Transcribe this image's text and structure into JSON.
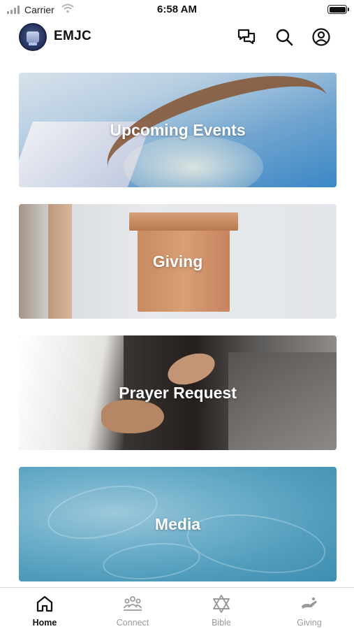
{
  "status_bar": {
    "carrier": "Carrier",
    "time": "6:58 AM"
  },
  "header": {
    "brand": "EMJC",
    "icons": [
      "chat-icon",
      "search-icon",
      "profile-icon"
    ]
  },
  "cards": [
    {
      "title": "Upcoming Events"
    },
    {
      "title": "Giving"
    },
    {
      "title": "Prayer Request"
    },
    {
      "title": "Media"
    }
  ],
  "tabs": [
    {
      "label": "Home",
      "icon": "home-icon",
      "active": true
    },
    {
      "label": "Connect",
      "icon": "people-icon",
      "active": false
    },
    {
      "label": "Bible",
      "icon": "star-of-david-icon",
      "active": false
    },
    {
      "label": "Giving",
      "icon": "giving-hand-icon",
      "active": false
    }
  ],
  "colors": {
    "active_tab": "#111111",
    "inactive_tab": "#9a9a9a"
  }
}
